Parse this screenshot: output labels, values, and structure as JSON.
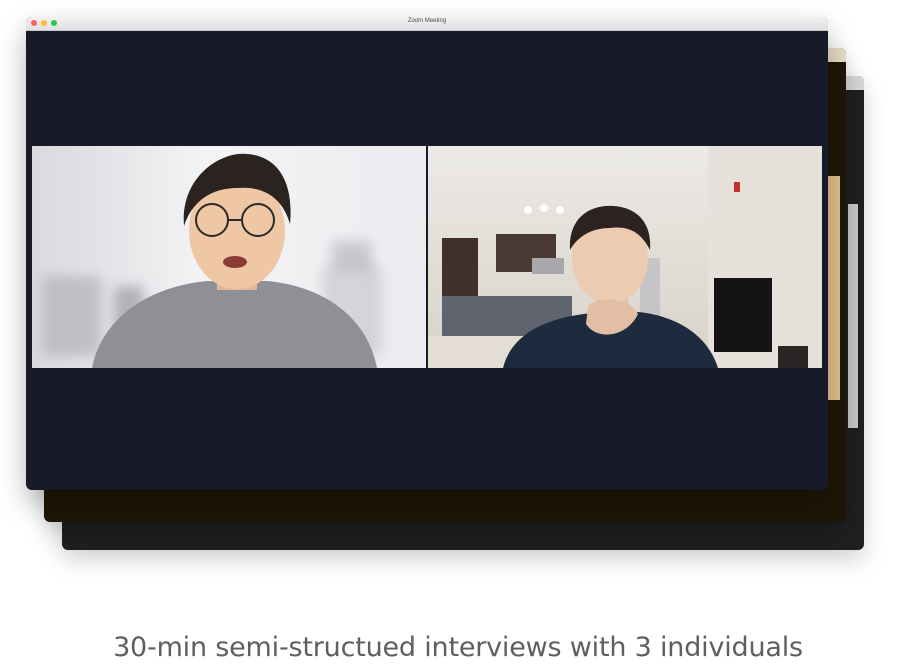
{
  "window": {
    "title": "Zoom Meeting"
  },
  "participants": [
    {
      "icon": "participant-video-left"
    },
    {
      "icon": "participant-video-right"
    }
  ],
  "caption": "30-min semi-structued interviews with 3 individuals",
  "colors": {
    "window_bg": "#171a28",
    "caption_text": "#5f5f5f",
    "back_window_2": "#1e1606",
    "back_window_3": "#1f1f21"
  }
}
